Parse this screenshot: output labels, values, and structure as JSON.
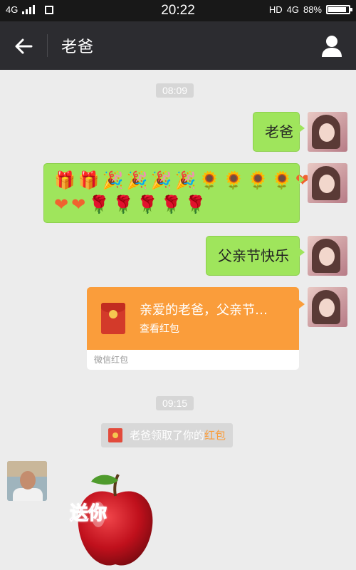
{
  "status_bar": {
    "network": "4G",
    "time": "20:22",
    "hd": "HD",
    "network_right": "4G",
    "battery": "88%",
    "battery_level": 0.88
  },
  "header": {
    "title": "老爸"
  },
  "timestamps": [
    "08:09",
    "09:15"
  ],
  "messages": {
    "msg1": "老爸",
    "emoji_row1": [
      "🎁",
      "🎁",
      "🎉",
      "🎉",
      "🎉",
      "🎉",
      "🌻",
      "🌻",
      "🌻",
      "🌻",
      "❤"
    ],
    "emoji_row2": [
      "❤",
      "❤",
      "🌹",
      "🌹",
      "🌹",
      "🌹",
      "🌹"
    ],
    "msg3": "父亲节快乐"
  },
  "red_packet": {
    "main_text": "亲爱的老爸，父亲节…",
    "sub_text": "查看红包",
    "footer": "微信红包"
  },
  "system_note": {
    "prefix": "老爸领取了你的",
    "highlight": "红包"
  },
  "sticker": {
    "text": "送你"
  },
  "colors": {
    "bubble_green": "#9fe55c",
    "red_packet_orange": "#fa9d3b",
    "title_bar": "#2c2c30"
  }
}
